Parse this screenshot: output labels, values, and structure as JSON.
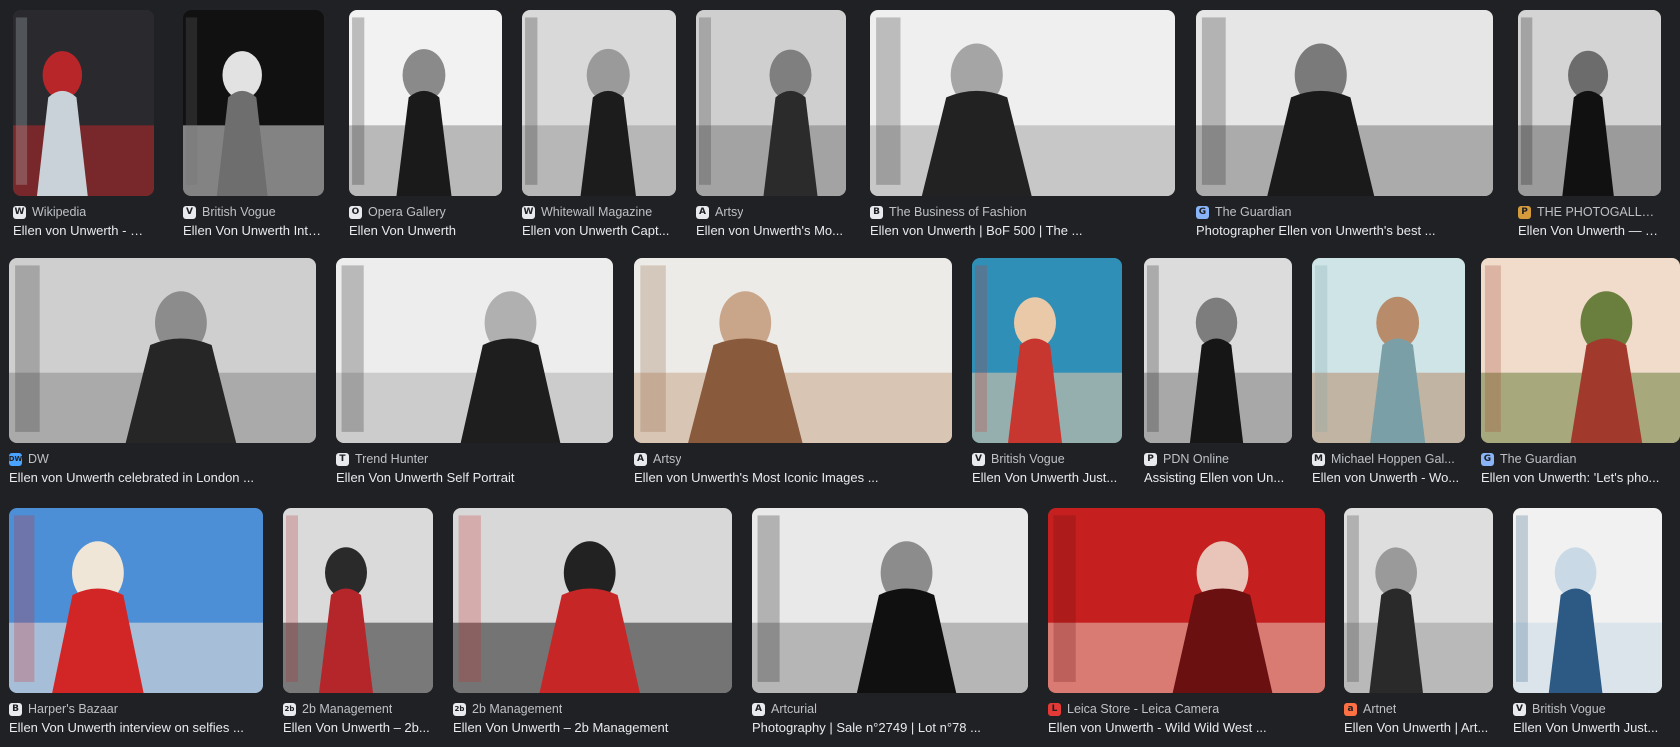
{
  "results": [
    {
      "source": "Wikipedia",
      "favicon": "wikipedia-icon",
      "glyph": "W",
      "fav_color": "#e8eaed",
      "title": "Ellen von Unwerth - Wi...",
      "palette": [
        "#2a2a2e",
        "#c9d2d8",
        "#b8262a"
      ]
    },
    {
      "source": "British Vogue",
      "favicon": "vogue-icon",
      "glyph": "V",
      "fav_color": "#e8eaed",
      "title": "Ellen Von Unwerth Inte...",
      "palette": [
        "#111111",
        "#6e6e6e",
        "#e2e2e2"
      ]
    },
    {
      "source": "Opera Gallery",
      "favicon": "opera-gallery-icon",
      "glyph": "O",
      "fav_color": "#e8eaed",
      "title": "Ellen Von Unwerth",
      "palette": [
        "#f2f2f2",
        "#1a1a1a",
        "#8a8a8a"
      ]
    },
    {
      "source": "Whitewall Magazine",
      "favicon": "whitewall-icon",
      "glyph": "W",
      "fav_color": "#e8eaed",
      "title": "Ellen von Unwerth Capt...",
      "palette": [
        "#d9d9d9",
        "#1c1c1c",
        "#9a9a9a"
      ]
    },
    {
      "source": "Artsy",
      "favicon": "artsy-icon",
      "glyph": "A",
      "fav_color": "#e8eaed",
      "title": "Ellen von Unwerth's Mo...",
      "palette": [
        "#cfcfcf",
        "#2b2b2b",
        "#7f7f7f"
      ]
    },
    {
      "source": "The Business of Fashion",
      "favicon": "bof-icon",
      "glyph": "B",
      "fav_color": "#e8eaed",
      "title": "Ellen von Unwerth | BoF 500 | The ...",
      "palette": [
        "#efefef",
        "#222222",
        "#a5a5a5"
      ]
    },
    {
      "source": "The Guardian",
      "favicon": "guardian-icon",
      "glyph": "G",
      "fav_color": "#8ab4f8",
      "title": "Photographer Ellen von Unwerth's best ...",
      "palette": [
        "#e6e6e6",
        "#1a1a1a",
        "#7a7a7a"
      ]
    },
    {
      "source": "THE PHOTOGALLERY",
      "favicon": "photogallery-icon",
      "glyph": "P",
      "fav_color": "#d59a3c",
      "title": "Ellen Von Unwerth — T...",
      "palette": [
        "#d4d4d4",
        "#111111",
        "#6c6c6c"
      ]
    },
    {
      "source": "DW",
      "favicon": "dw-icon",
      "glyph": "DW",
      "fav_color": "#4aa3ff",
      "title": "Ellen von Unwerth celebrated in London ...",
      "palette": [
        "#cfcfcf",
        "#262626",
        "#8c8c8c"
      ]
    },
    {
      "source": "Trend Hunter",
      "favicon": "trend-hunter-icon",
      "glyph": "T",
      "fav_color": "#e8eaed",
      "title": "Ellen Von Unwerth Self Portrait",
      "palette": [
        "#ededed",
        "#1e1e1e",
        "#b0b0b0"
      ]
    },
    {
      "source": "Artsy",
      "favicon": "artsy-icon",
      "glyph": "A",
      "fav_color": "#e8eaed",
      "title": "Ellen von Unwerth's Most Iconic Images ...",
      "palette": [
        "#ecebe7",
        "#8a5a3c",
        "#c9a58a"
      ]
    },
    {
      "source": "British Vogue",
      "favicon": "vogue-icon",
      "glyph": "V",
      "fav_color": "#e8eaed",
      "title": "Ellen Von Unwerth Just...",
      "palette": [
        "#2f8fb6",
        "#c7362f",
        "#e9c9a8"
      ]
    },
    {
      "source": "PDN Online",
      "favicon": "pdn-icon",
      "glyph": "P",
      "fav_color": "#e8eaed",
      "title": "Assisting Ellen von Un...",
      "palette": [
        "#dcdcdc",
        "#161616",
        "#7d7d7d"
      ]
    },
    {
      "source": "Michael Hoppen Gal...",
      "favicon": "hoppen-icon",
      "glyph": "M",
      "fav_color": "#e8eaed",
      "title": "Ellen von Unwerth - Wo...",
      "palette": [
        "#cfe4e6",
        "#7a9fa6",
        "#b88c6a"
      ]
    },
    {
      "source": "The Guardian",
      "favicon": "guardian-icon",
      "glyph": "G",
      "fav_color": "#8ab4f8",
      "title": "Ellen von Unwerth: 'Let's pho...",
      "palette": [
        "#f1dccb",
        "#a13a2d",
        "#6a7f3e"
      ]
    },
    {
      "source": "Harper's Bazaar",
      "favicon": "harpers-icon",
      "glyph": "B",
      "fav_color": "#e8eaed",
      "title": "Ellen Von Unwerth interview on selfies ...",
      "palette": [
        "#4c8fd6",
        "#d22626",
        "#f0e6d8"
      ]
    },
    {
      "source": "2b Management",
      "favicon": "2b-management-icon",
      "glyph": "2b",
      "fav_color": "#e8eaed",
      "title": "Ellen Von Unwerth – 2b...",
      "palette": [
        "#dadada",
        "#b5262a",
        "#2a2a2a"
      ]
    },
    {
      "source": "2b Management",
      "favicon": "2b-management-icon",
      "glyph": "2b",
      "fav_color": "#e8eaed",
      "title": "Ellen Von Unwerth – 2b Management",
      "palette": [
        "#d8d8d8",
        "#c62626",
        "#222222"
      ]
    },
    {
      "source": "Artcurial",
      "favicon": "artcurial-icon",
      "glyph": "A",
      "fav_color": "#e8eaed",
      "title": "Photography | Sale n°2749 | Lot n°78 ...",
      "palette": [
        "#e9e9e9",
        "#101010",
        "#8c8c8c"
      ]
    },
    {
      "source": "Leica Store - Leica Camera",
      "favicon": "leica-icon",
      "glyph": "L",
      "fav_color": "#e53935",
      "title": "Ellen von Unwerth - Wild Wild West ...",
      "palette": [
        "#c51f1f",
        "#6b1010",
        "#e9c4b8"
      ]
    },
    {
      "source": "Artnet",
      "favicon": "artnet-icon",
      "glyph": "a",
      "fav_color": "#ff7043",
      "title": "Ellen Von Unwerth | Art...",
      "palette": [
        "#dedede",
        "#2a2a2a",
        "#9a9a9a"
      ]
    },
    {
      "source": "British Vogue",
      "favicon": "vogue-icon",
      "glyph": "V",
      "fav_color": "#e8eaed",
      "title": "Ellen Von Unwerth Just...",
      "palette": [
        "#f1f1f1",
        "#2c5a84",
        "#c9d9e6"
      ]
    }
  ]
}
